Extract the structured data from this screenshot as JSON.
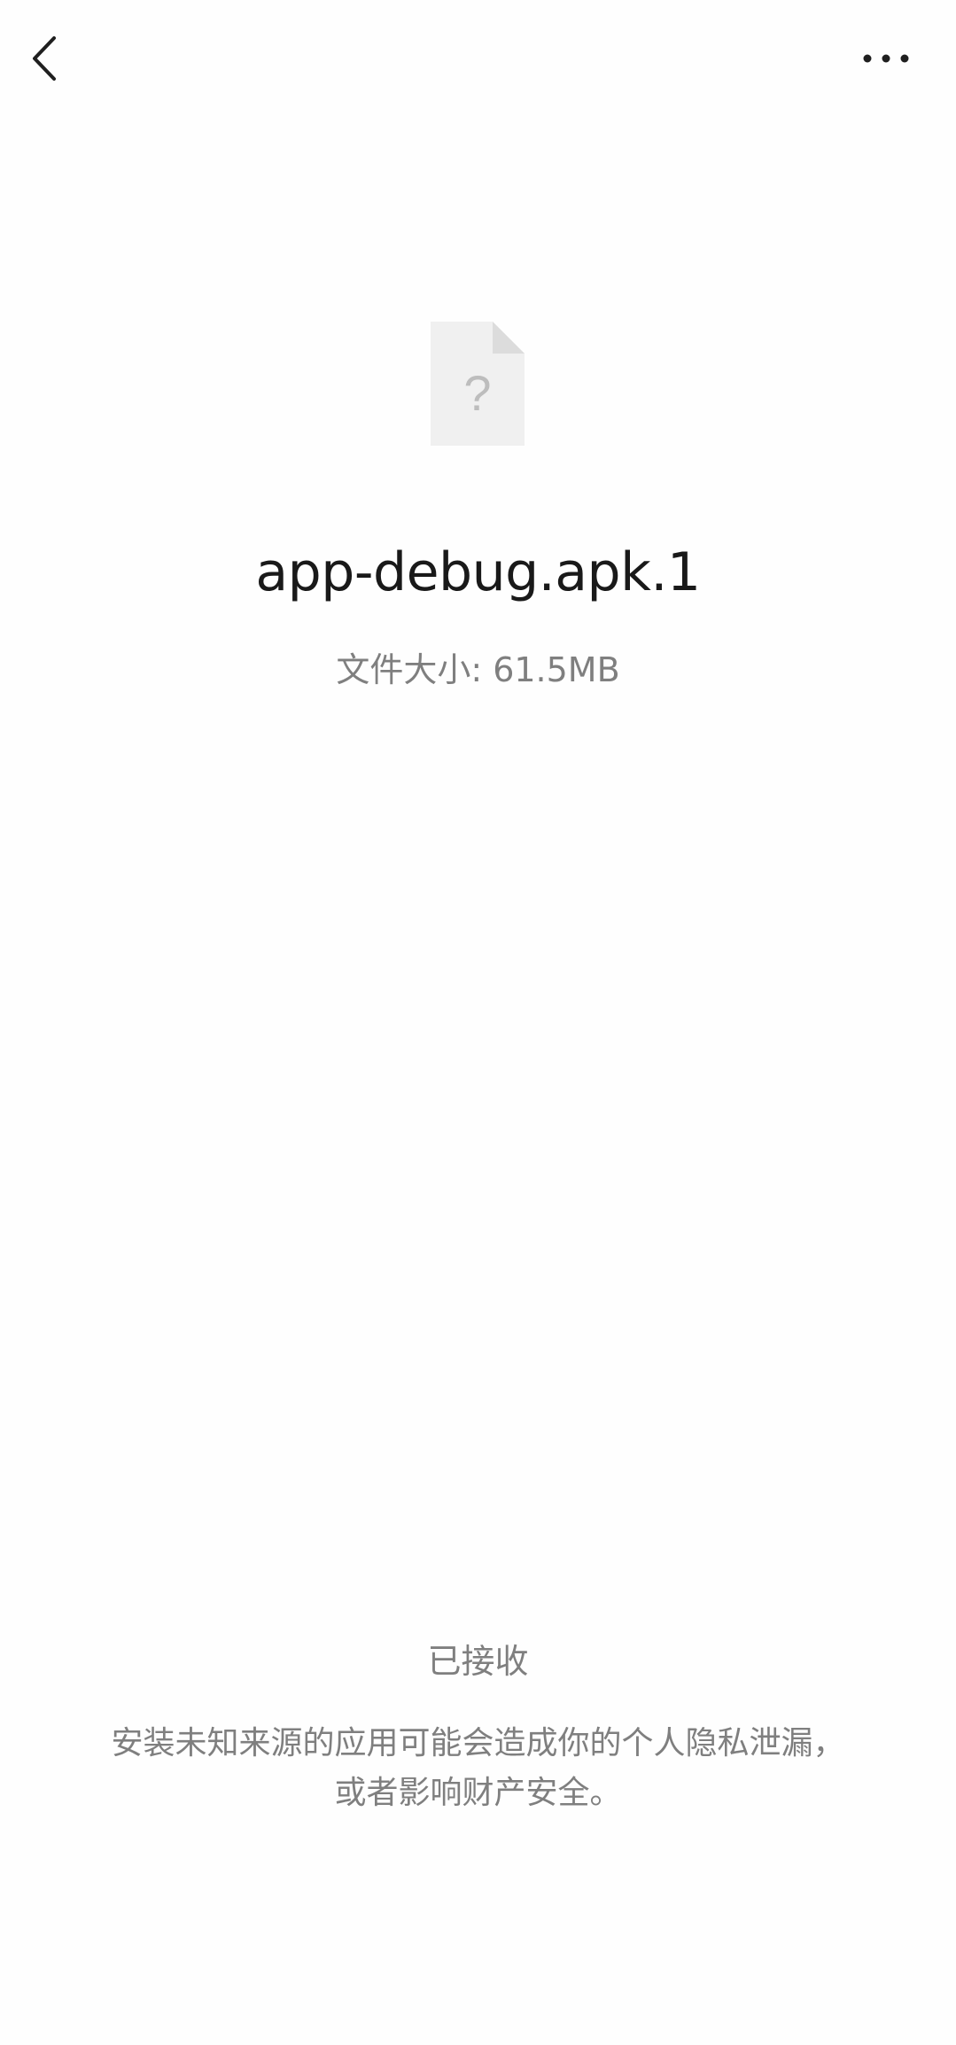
{
  "header": {
    "back_icon": "chevron-left-icon",
    "more_icon": "more-horizontal-icon"
  },
  "file": {
    "icon": "unknown-file-icon",
    "icon_glyph": "?",
    "name": "app-debug.apk.1",
    "size_text": "文件大小: 61.5MB"
  },
  "footer": {
    "status": "已接收",
    "warning_line1": "安装未知来源的应用可能会造成你的个人隐私泄漏，",
    "warning_line2": "或者影响财产安全。"
  },
  "colors": {
    "background": "#fefefe",
    "primary_text": "#191919",
    "secondary_text": "#7f7f7f",
    "file_icon_body": "#f0f0f0",
    "file_icon_fold": "#dcdcdc"
  }
}
